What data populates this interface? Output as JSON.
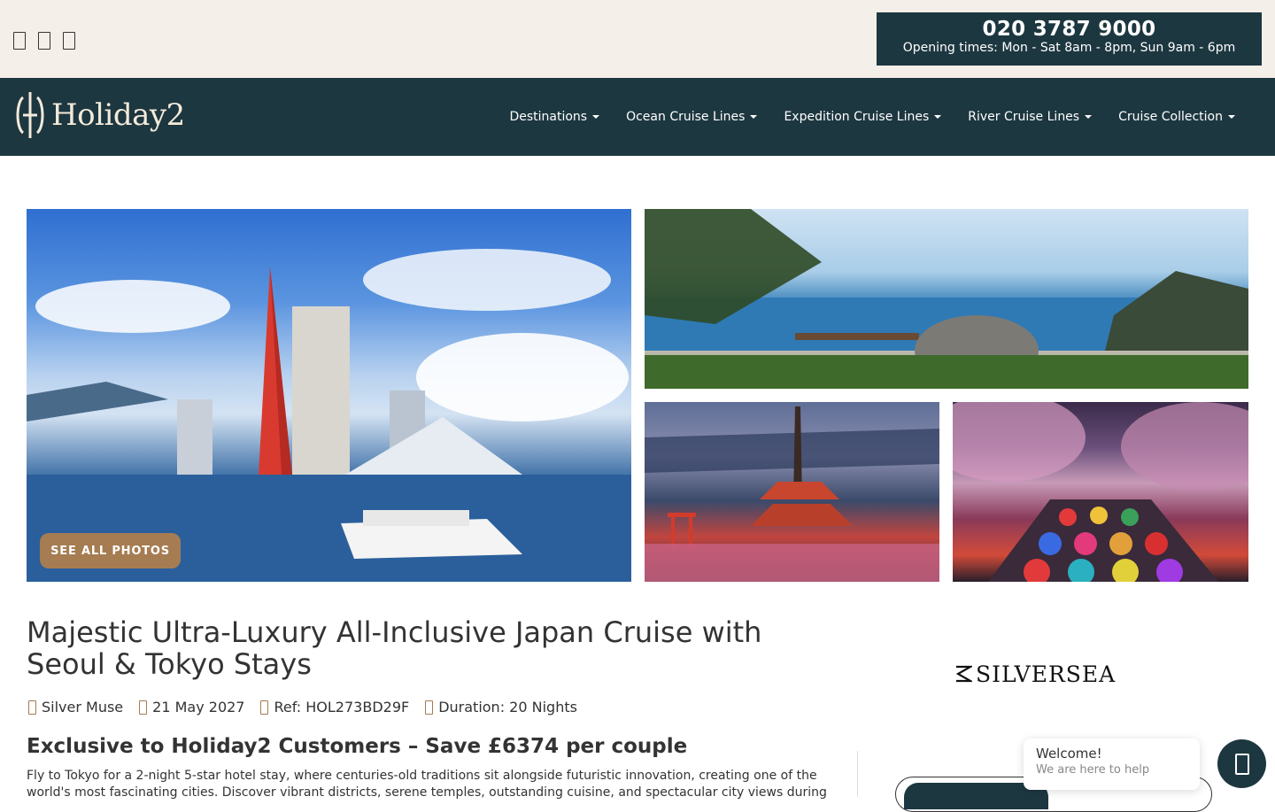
{
  "topbar": {
    "social_icons": [
      "facebook-icon",
      "instagram-icon",
      "twitter-icon"
    ],
    "phone": "020 3787 9000",
    "opening_times": "Opening times: Mon - Sat 8am - 8pm, Sun 9am - 6pm"
  },
  "nav": {
    "logo_text": "Holiday2",
    "items": [
      {
        "label": "Destinations"
      },
      {
        "label": "Ocean Cruise Lines"
      },
      {
        "label": "Expedition Cruise Lines"
      },
      {
        "label": "River Cruise Lines"
      },
      {
        "label": "Cruise Collection"
      }
    ]
  },
  "gallery": {
    "see_all_label": "SEE ALL PHOTOS"
  },
  "cruise": {
    "title": "Majestic Ultra-Luxury All-Inclusive Japan Cruise with Seoul & Tokyo Stays",
    "ship": "Silver Muse",
    "date": "21 May 2027",
    "ref": "Ref: HOL273BD29F",
    "duration": "Duration: 20 Nights",
    "exclusive_heading": "Exclusive to Holiday2 Customers – Save £6374 per couple",
    "description": "Fly to Tokyo for a 2-night 5-star hotel stay, where centuries-old traditions sit alongside futuristic innovation, creating one of the world's most fascinating cities. Discover vibrant districts, serene temples, outstanding cuisine, and spectacular city views during"
  },
  "brand": {
    "name": "SILVERSEA"
  },
  "chat": {
    "title": "Welcome!",
    "subtitle": "We are here to help"
  },
  "colors": {
    "navy": "#1d3740",
    "cream": "#f5efe9",
    "gold": "#a67c52"
  }
}
